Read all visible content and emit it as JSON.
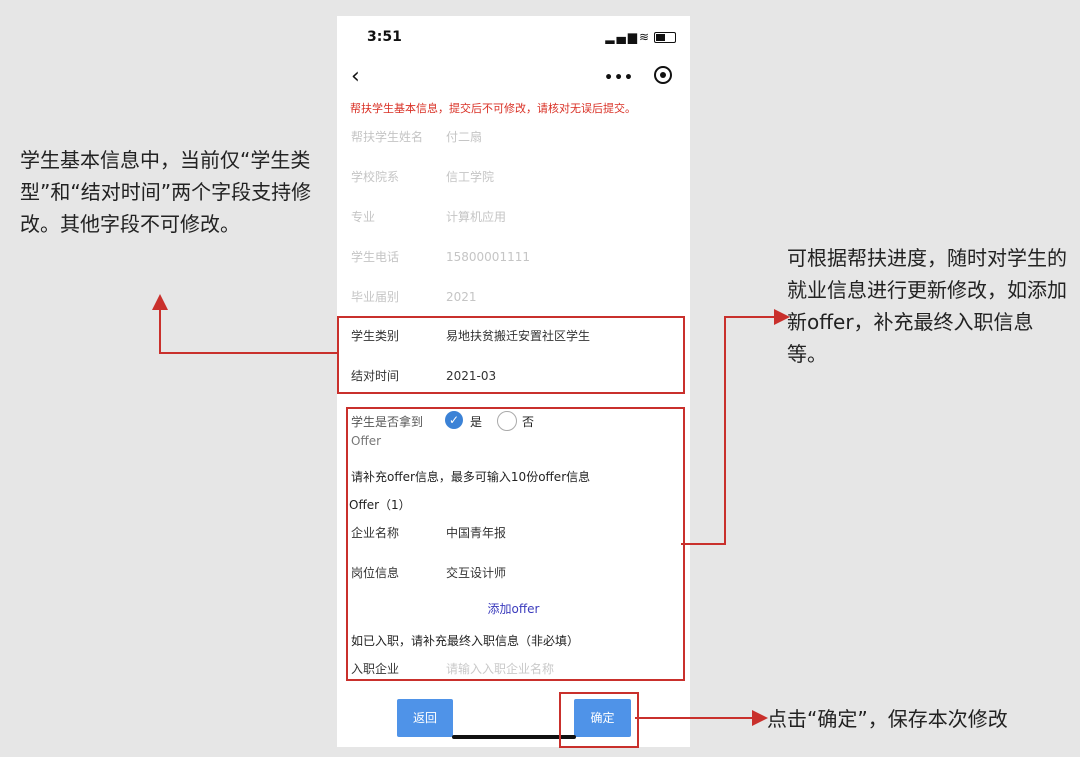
{
  "status_bar": {
    "time": "3:51"
  },
  "header": {
    "back_icon": "‹",
    "more_icon": "•••"
  },
  "warning_text": "帮扶学生基本信息，提交后不可修改，请核对无误后提交。",
  "basic_info": [
    {
      "label": "帮扶学生姓名",
      "value": "付二扇"
    },
    {
      "label": "学校院系",
      "value": "信工学院"
    },
    {
      "label": "专业",
      "value": "计算机应用"
    },
    {
      "label": "学生电话",
      "value": "15800001111"
    },
    {
      "label": "毕业届别",
      "value": "2021"
    }
  ],
  "editable_info": [
    {
      "label": "学生类别",
      "value": "易地扶贫搬迁安置社区学生"
    },
    {
      "label": "结对时间",
      "value": "2021-03"
    }
  ],
  "offer_section": {
    "question_line1": "学生是否拿到",
    "question_line2": "Offer",
    "yes_label": "是",
    "no_label": "否",
    "hint": "请补充offer信息，最多可输入10份offer信息",
    "offer_title": "Offer（1）",
    "fields": [
      {
        "label": "企业名称",
        "value": "中国青年报"
      },
      {
        "label": "岗位信息",
        "value": "交互设计师"
      }
    ],
    "add_offer": "添加offer",
    "final_hint": "如已入职，请补充最终入职信息（非必填）",
    "final_label": "入职企业",
    "final_placeholder": "请输入入职企业名称"
  },
  "buttons": {
    "back": "返回",
    "confirm": "确定"
  },
  "annotations": {
    "left": "学生基本信息中，当前仅“学生类型”和“结对时间”两个字段支持修改。其他字段不可修改。",
    "right": "可根据帮扶进度，随时对学生的就业信息进行更新修改，如添加新offer，补充最终入职信息等。",
    "bottom": "点击“确定”，保存本次修改"
  },
  "colors": {
    "highlight": "#c9302c",
    "button": "#4f93e8",
    "warning": "#d93025",
    "check": "#3b82d6"
  }
}
